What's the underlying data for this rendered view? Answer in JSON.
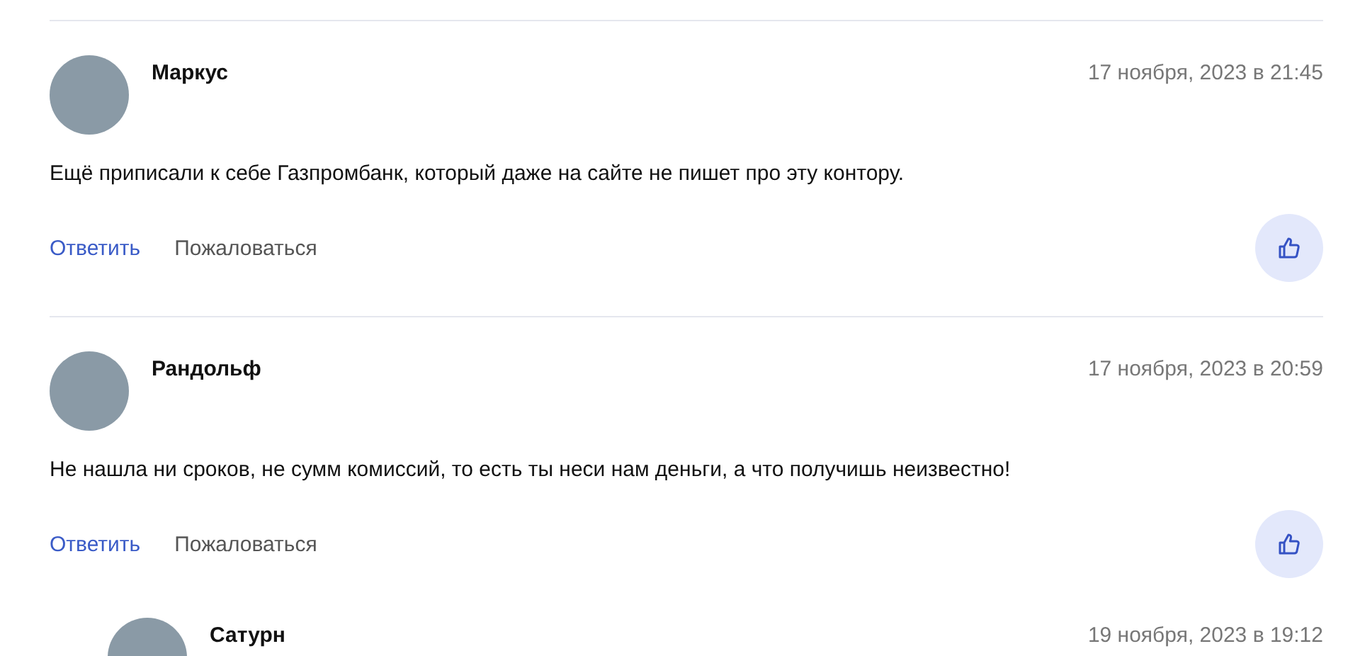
{
  "comments": [
    {
      "author": "Маркус",
      "date": "17 ноября, 2023 в 21:45",
      "text": "Ещё приписали к себе Газпромбанк, который даже на сайте не пишет про эту контору.",
      "actions": [
        "Ответить",
        "Пожаловаться"
      ]
    },
    {
      "author": "Рандольф",
      "date": "17 ноября, 2023 в 20:59",
      "text": "Не нашла ни сроков, не сумм комиссий, то есть ты неси нам деньги, а что получишь неизвестно!",
      "actions": [
        "Ответить",
        "Пожаловаться"
      ],
      "children": [
        {
          "author": "Сатурн",
          "date": "19 ноября, 2023 в 19:12"
        }
      ]
    }
  ]
}
